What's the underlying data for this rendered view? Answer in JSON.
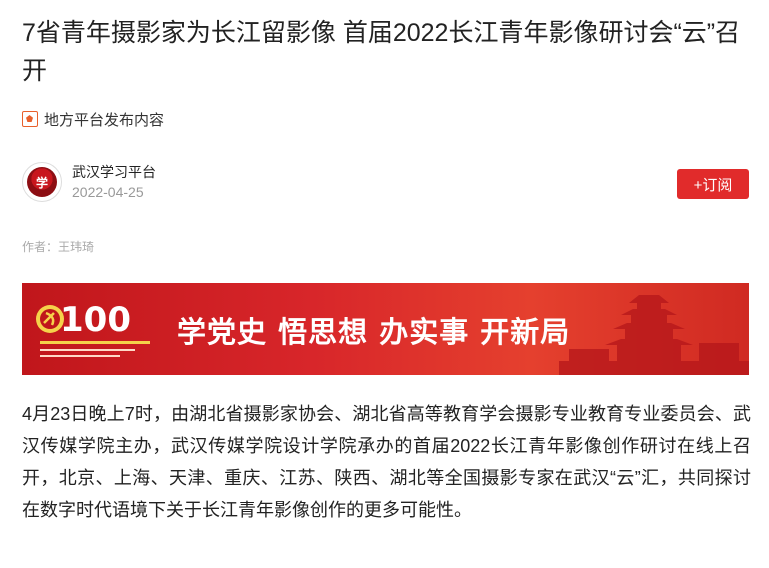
{
  "article": {
    "title": "7省青年摄影家为长江留影像 首届2022长江青年影像研讨会“云”召开",
    "source_label": "地方平台发布内容",
    "author_name": "武汉学习平台",
    "author_date": "2022-04-25",
    "subscribe_label": "+订阅",
    "byline": "作者：王玮琦",
    "banner": {
      "emblem_number": "100",
      "slogan": "学党史 悟思想 办实事 开新局"
    },
    "body": "4月23日晚上7时，由湖北省摄影家协会、湖北省高等教育学会摄影专业教育专业委员会、武汉传媒学院主办，武汉传媒学院设计学院承办的首届2022长江青年影像创作研讨在线上召开，北京、上海、天津、重庆、江苏、陕西、湖北等全国摄影专家在武汉“云”汇，共同探讨在数字时代语境下关于长江青年影像创作的更多可能性。"
  },
  "colors": {
    "accent": "#e12b2b",
    "banner_red": "#d8262a",
    "source_icon": "#e8602c"
  },
  "icons": {
    "source": "platform-badge-icon",
    "avatar": "wuhan-logo-avatar"
  }
}
